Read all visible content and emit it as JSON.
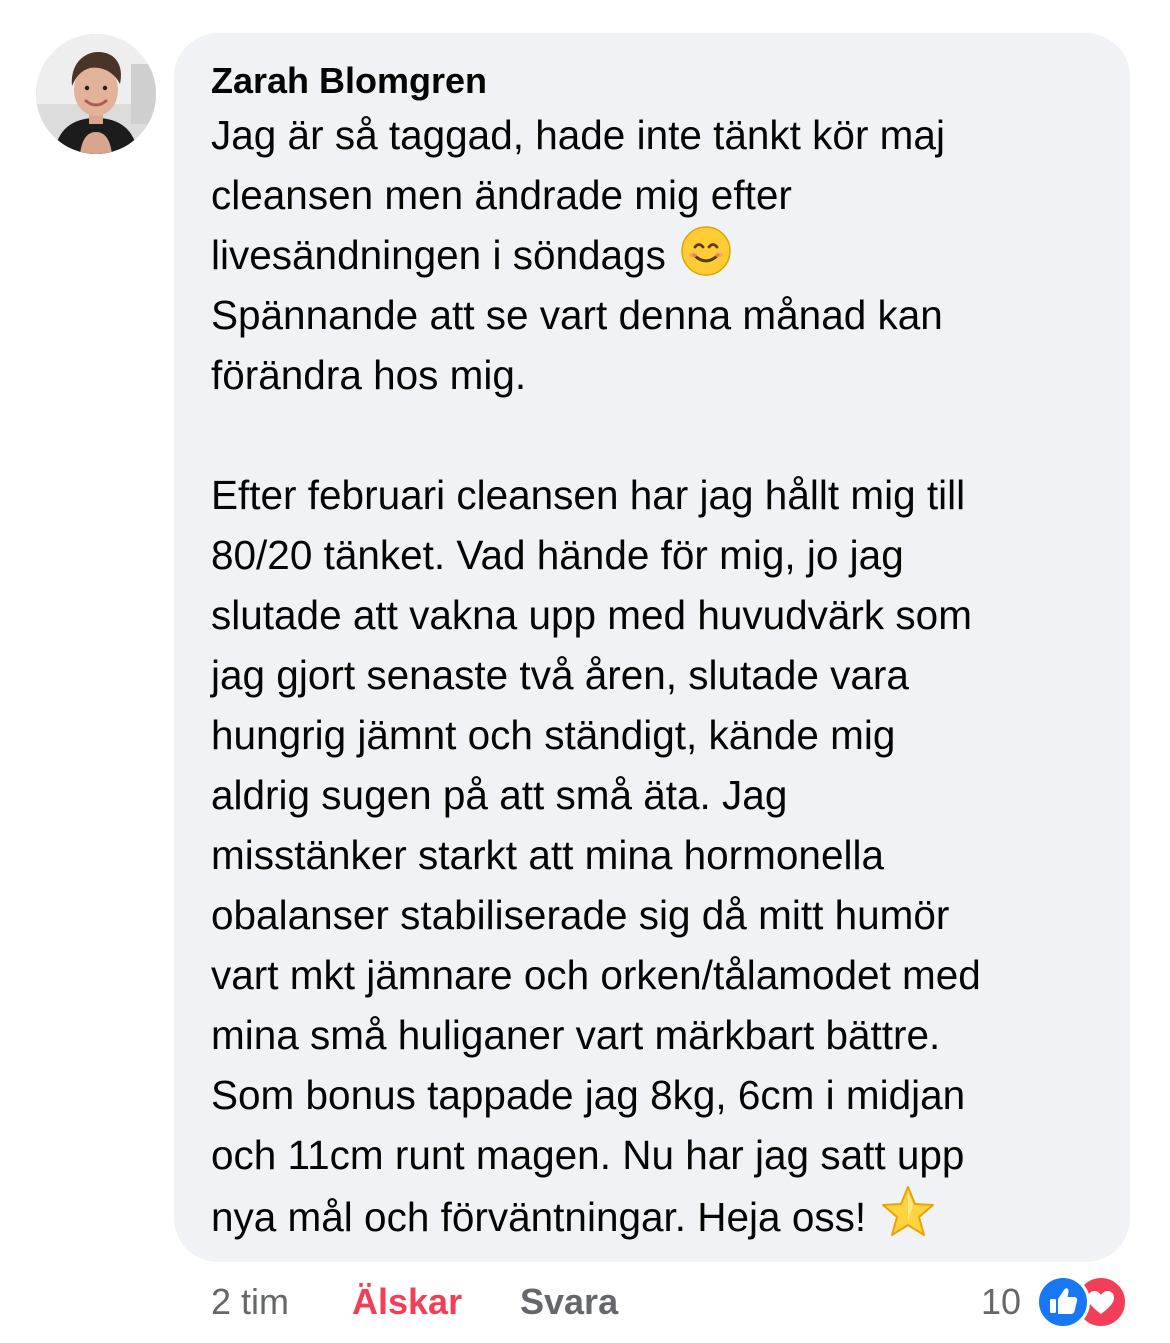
{
  "comment": {
    "author": "Zarah Blomgren",
    "lines": [
      "Jag är så taggad, hade inte tänkt kör maj",
      "cleansen men ändrade mig efter",
      "livesändningen i söndags",
      "Spännande att se vart denna månad kan",
      "förändra hos mig.",
      "",
      "Efter februari cleansen har jag hållt mig till",
      "80/20 tänket. Vad hände för mig, jo jag",
      "slutade att vakna upp med huvudvärk som",
      "jag gjort senaste två åren, slutade vara",
      "hungrig jämnt och ständigt, kände mig",
      "aldrig sugen på att små äta. Jag",
      "misstänker starkt att mina hormonella",
      "obalanser stabiliserade sig då mitt humör",
      "vart mkt jämnare och orken/tålamodet med",
      "mina små huliganer vart märkbart bättre.",
      "Som bonus tappade jag 8kg, 6cm i midjan",
      "och 11cm runt magen. Nu har jag satt upp",
      "nya mål och förväntningar. Heja oss!"
    ],
    "emojis": [
      "smiling-face-icon",
      "star-icon"
    ]
  },
  "footer": {
    "timestamp": "2 tim",
    "love_label": "Älskar",
    "reply_label": "Svara",
    "reaction_count": "10",
    "reactions": [
      "like-icon",
      "heart-icon"
    ]
  },
  "colors": {
    "bubble": "#f0f2f5",
    "love": "#f33e58",
    "like": "#1877f2",
    "meta": "#65676b"
  }
}
